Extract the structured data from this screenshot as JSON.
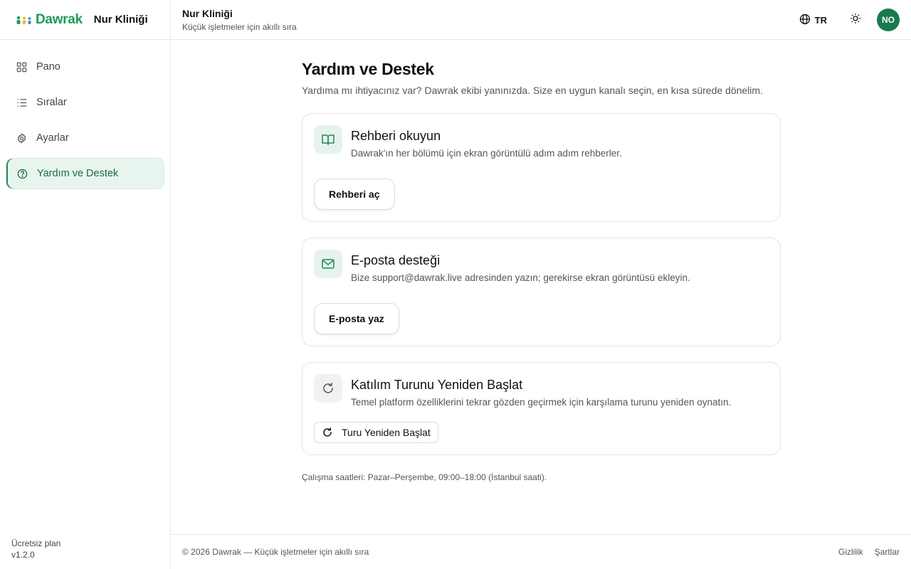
{
  "brand": {
    "logo_text": "Dawrak",
    "business_name": "Nur Kliniği",
    "logo_colors": [
      "#1f9a57",
      "#f2b630",
      "#2d8fd4"
    ]
  },
  "sidebar": {
    "items": [
      {
        "label": "Pano",
        "icon": "grid-icon",
        "active": false
      },
      {
        "label": "Sıralar",
        "icon": "list-icon",
        "active": false
      },
      {
        "label": "Ayarlar",
        "icon": "gear-icon",
        "active": false
      },
      {
        "label": "Yardım ve Destek",
        "icon": "help-circle-icon",
        "active": true
      }
    ],
    "plan": "Ücretsiz plan",
    "version": "v1.2.0"
  },
  "topbar": {
    "title": "Nur Kliniği",
    "subtitle": "Küçük işletmeler için akıllı sıra",
    "language": "TR",
    "avatar_initials": "NO"
  },
  "main": {
    "title": "Yardım ve Destek",
    "lead": "Yardıma mı ihtiyacınız var? Dawrak ekibi yanınızda. Size en uygun kanalı seçin, en kısa sürede dönelim.",
    "cards": [
      {
        "title": "Rehberi okuyun",
        "description": "Dawrak'ın her bölümü için ekran görüntülü adım adım rehberler.",
        "button": "Rehberi aç",
        "icon": "book-icon"
      },
      {
        "title": "E-posta desteği",
        "description": "Bize support@dawrak.live adresinden yazın; gerekirse ekran görüntüsü ekleyin.",
        "button": "E-posta yaz",
        "icon": "mail-icon"
      },
      {
        "title": "Katılım Turunu Yeniden Başlat",
        "description": "Temel platform özelliklerini tekrar gözden geçirmek için karşılama turunu yeniden oynatın.",
        "button": "Turu Yeniden Başlat",
        "icon": "refresh-icon"
      }
    ],
    "hours": "Çalışma saatleri: Pazar–Perşembe, 09:00–18:00 (İstanbul saati)."
  },
  "footer": {
    "copyright": "© 2026 Dawrak — Küçük işletmeler için akıllı sıra",
    "links": [
      "Gizlilik",
      "Şartlar"
    ]
  },
  "colors": {
    "accent": "#1f8a55",
    "active_bg": "#e8f5ee",
    "avatar_bg": "#1a7a4c"
  }
}
